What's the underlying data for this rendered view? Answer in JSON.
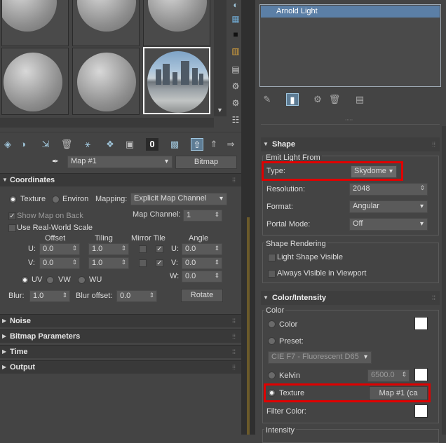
{
  "material_editor": {
    "map_name": "Map #1",
    "map_type_button": "Bitmap",
    "coordinates": {
      "header": "Coordinates",
      "texture_label": "Texture",
      "environ_label": "Environ",
      "mapping_label": "Mapping:",
      "mapping_value": "Explicit Map Channel",
      "show_map_on_back": "Show Map on Back",
      "map_channel_label": "Map Channel:",
      "map_channel_value": "1",
      "use_real_world_scale": "Use Real-World Scale",
      "col_offset": "Offset",
      "col_tiling": "Tiling",
      "col_mirror_tile": "Mirror Tile",
      "col_angle": "Angle",
      "u_label": "U:",
      "v_label": "V:",
      "w_label": "W:",
      "u_offset": "0.0",
      "v_offset": "0.0",
      "u_tiling": "1.0",
      "v_tiling": "1.0",
      "u_angle": "0.0",
      "v_angle": "0.0",
      "w_angle": "0.0",
      "uv_label": "UV",
      "vw_label": "VW",
      "wu_label": "WU",
      "blur_label": "Blur:",
      "blur_value": "1.0",
      "blur_offset_label": "Blur offset:",
      "blur_offset_value": "0.0",
      "rotate_button": "Rotate"
    },
    "rollouts": [
      "Noise",
      "Bitmap Parameters",
      "Time",
      "Output"
    ]
  },
  "command_panel": {
    "light_list_item": "Arnold Light",
    "shape": {
      "header": "Shape",
      "emit_light_from": "Emit Light From",
      "type_label": "Type:",
      "type_value": "Skydome",
      "resolution_label": "Resolution:",
      "resolution_value": "2048",
      "format_label": "Format:",
      "format_value": "Angular",
      "portal_mode_label": "Portal Mode:",
      "portal_mode_value": "Off",
      "shape_rendering": "Shape Rendering",
      "light_shape_visible": "Light Shape Visible",
      "always_visible_viewport": "Always Visible in Viewport"
    },
    "color_intensity": {
      "header": "Color/Intensity",
      "color_group": "Color",
      "color_label": "Color",
      "preset_label": "Preset:",
      "preset_value": "CIE F7 - Fluorescent D65",
      "kelvin_label": "Kelvin",
      "kelvin_value": "6500.0",
      "texture_label": "Texture",
      "texture_value": "Map #1 (ca",
      "filter_color_label": "Filter Color:",
      "intensity_group": "Intensity"
    }
  },
  "colors": {
    "highlight": "#e00000",
    "selection": "#5b7fa6",
    "panel_bg": "#444444"
  }
}
